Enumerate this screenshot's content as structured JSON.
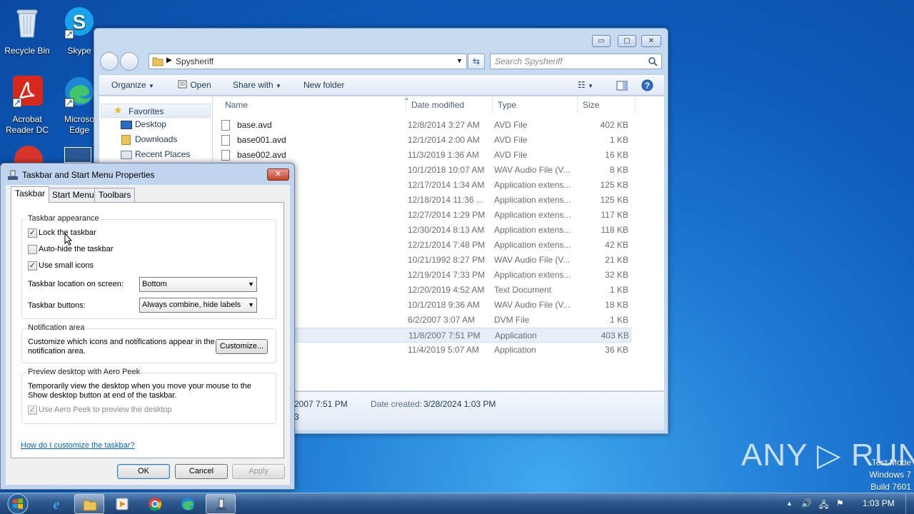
{
  "desktop": {
    "icons": [
      {
        "label": "Recycle Bin",
        "icon": "recycle-bin-icon"
      },
      {
        "label": "Skype",
        "icon": "skype-icon"
      },
      {
        "label": "Acrobat Reader DC",
        "line1": "Acrobat",
        "line2": "Reader DC",
        "icon": "acrobat-icon"
      },
      {
        "label": "Microsoft Edge",
        "line1": "Microso",
        "line2": "Edge",
        "icon": "edge-icon"
      }
    ],
    "watermark": {
      "brand": "ANY ▷ RUN",
      "line1": "Test Mode",
      "line2": "Windows 7",
      "line3": "Build 7601"
    }
  },
  "explorer": {
    "window_controls": {
      "minimize": "▭",
      "maximize": "▢",
      "close": "✕"
    },
    "address": {
      "path": "Spysheriff"
    },
    "search": {
      "placeholder": "Search Spysheriff"
    },
    "toolbar": {
      "organize": "Organize",
      "open": "Open",
      "share_with": "Share with",
      "new_folder": "New folder"
    },
    "nav": {
      "favorites": "Favorites",
      "items": [
        "Desktop",
        "Downloads",
        "Recent Places"
      ]
    },
    "columns": {
      "name": "Name",
      "date_modified": "Date modified",
      "type": "Type",
      "size": "Size"
    },
    "files": [
      {
        "name": "base.avd",
        "date": "12/8/2014 3:27 AM",
        "type": "AVD File",
        "size": "402 KB"
      },
      {
        "name": "base001.avd",
        "date": "12/1/2014 2:00 AM",
        "type": "AVD File",
        "size": "1 KB"
      },
      {
        "name": "base002.avd",
        "date": "11/3/2019 1:36 AM",
        "type": "AVD File",
        "size": "16 KB"
      },
      {
        "name": "",
        "date": "10/1/2018 10:07 AM",
        "type": "WAV Audio File (V...",
        "size": "8 KB"
      },
      {
        "name": "",
        "date": "12/17/2014 1:34 AM",
        "type": "Application extens...",
        "size": "125 KB"
      },
      {
        "name": "",
        "date": "12/18/2014 11:36 ...",
        "type": "Application extens...",
        "size": "125 KB"
      },
      {
        "name": "",
        "date": "12/27/2014 1:29 PM",
        "type": "Application extens...",
        "size": "117 KB"
      },
      {
        "name": "",
        "date": "12/30/2014 8:13 AM",
        "type": "Application extens...",
        "size": "118 KB"
      },
      {
        "name": "",
        "date": "12/21/2014 7:48 PM",
        "type": "Application extens...",
        "size": "42 KB"
      },
      {
        "name": "",
        "date": "10/21/1992 8:27 PM",
        "type": "WAV Audio File (V...",
        "size": "21 KB"
      },
      {
        "name": "",
        "date": "12/19/2014 7:33 PM",
        "type": "Application extens...",
        "size": "32 KB"
      },
      {
        "name": "",
        "date": "12/20/2019 4:52 AM",
        "type": "Text Document",
        "size": "1 KB"
      },
      {
        "name": "",
        "date": "10/1/2018 9:36 AM",
        "type": "WAV Audio File (V...",
        "size": "18 KB"
      },
      {
        "name": "",
        "date": "6/2/2007 3:07 AM",
        "type": "DVM File",
        "size": "1 KB"
      },
      {
        "name": "",
        "date": "11/8/2007 7:51 PM",
        "type": "Application",
        "size": "403 KB"
      },
      {
        "name": "",
        "date": "11/4/2019 5:07 AM",
        "type": "Application",
        "size": "36 KB"
      }
    ],
    "details_pane": {
      "modified_partial": "2007 7:51 PM",
      "created_label": "Date created:",
      "created_value": "3/28/2024 1:03 PM",
      "partial_char": "3"
    }
  },
  "dialog": {
    "title": "Taskbar and Start Menu Properties",
    "close": "✕",
    "tabs": [
      "Taskbar",
      "Start Menu",
      "Toolbars"
    ],
    "appearance": {
      "title": "Taskbar appearance",
      "lock": {
        "label": "Lock the taskbar",
        "checked": "✓"
      },
      "autohide": {
        "label": "Auto-hide the taskbar",
        "checked": ""
      },
      "small_icons": {
        "label": "Use small icons",
        "checked": "✓"
      },
      "location_label": "Taskbar location on screen:",
      "location_value": "Bottom",
      "buttons_label": "Taskbar buttons:",
      "buttons_value": "Always combine, hide labels"
    },
    "notification": {
      "title": "Notification area",
      "text_line1": "Customize which icons and notifications appear in the",
      "text_line2": "notification area.",
      "customize": "Customize..."
    },
    "aero_peek": {
      "title": "Preview desktop with Aero Peek",
      "text_line1": "Temporarily view the desktop when you move your mouse to the",
      "text_line2": "Show desktop button at end of the taskbar.",
      "checkbox_label": "Use Aero Peek to preview the desktop",
      "checked": "✓"
    },
    "help_link": "How do I customize the taskbar?",
    "buttons": {
      "ok": "OK",
      "cancel": "Cancel",
      "apply": "Apply"
    }
  },
  "taskbar": {
    "apps": [
      "internet-explorer",
      "windows-explorer",
      "media-player",
      "chrome",
      "edge",
      "taskbar-properties"
    ],
    "clock": "1:03 PM"
  }
}
